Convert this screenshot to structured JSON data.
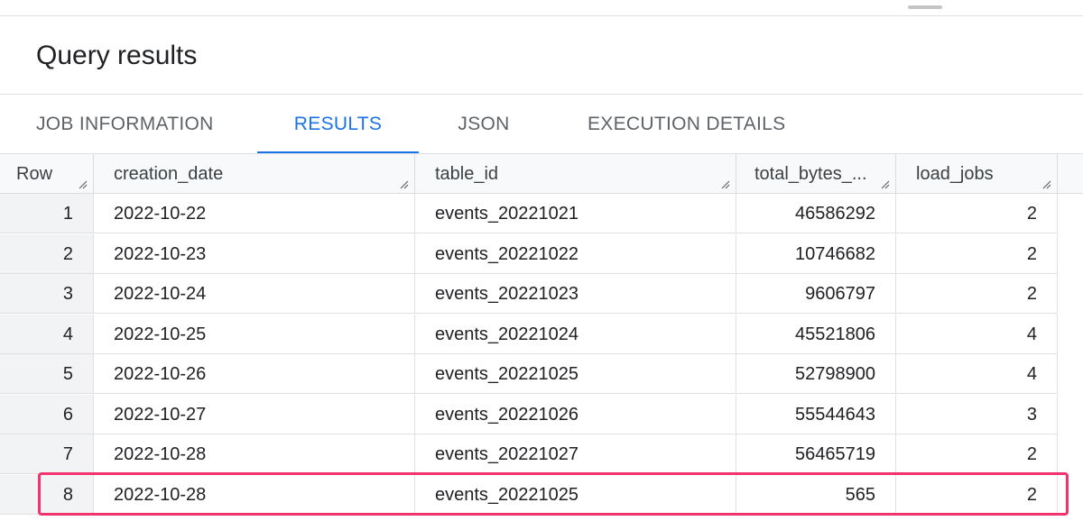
{
  "panel": {
    "title": "Query results"
  },
  "tabs": [
    {
      "label": "JOB INFORMATION",
      "active": false
    },
    {
      "label": "RESULTS",
      "active": true
    },
    {
      "label": "JSON",
      "active": false
    },
    {
      "label": "EXECUTION DETAILS",
      "active": false
    }
  ],
  "columns": [
    "Row",
    "creation_date",
    "table_id",
    "total_bytes_...",
    "load_jobs"
  ],
  "rows": [
    {
      "row": "1",
      "creation_date": "2022-10-22",
      "table_id": "events_20221021",
      "total_bytes": "46586292",
      "load_jobs": "2"
    },
    {
      "row": "2",
      "creation_date": "2022-10-23",
      "table_id": "events_20221022",
      "total_bytes": "10746682",
      "load_jobs": "2"
    },
    {
      "row": "3",
      "creation_date": "2022-10-24",
      "table_id": "events_20221023",
      "total_bytes": "9606797",
      "load_jobs": "2"
    },
    {
      "row": "4",
      "creation_date": "2022-10-25",
      "table_id": "events_20221024",
      "total_bytes": "45521806",
      "load_jobs": "4"
    },
    {
      "row": "5",
      "creation_date": "2022-10-26",
      "table_id": "events_20221025",
      "total_bytes": "52798900",
      "load_jobs": "4"
    },
    {
      "row": "6",
      "creation_date": "2022-10-27",
      "table_id": "events_20221026",
      "total_bytes": "55544643",
      "load_jobs": "3"
    },
    {
      "row": "7",
      "creation_date": "2022-10-28",
      "table_id": "events_20221027",
      "total_bytes": "56465719",
      "load_jobs": "2"
    },
    {
      "row": "8",
      "creation_date": "2022-10-28",
      "table_id": "events_20221025",
      "total_bytes": "565",
      "load_jobs": "2"
    }
  ],
  "highlighted_row": "8",
  "colors": {
    "accent": "#1a73e8",
    "highlight": "#f2336e",
    "header_bg": "#f8f9fa",
    "rownum_bg": "#f1f3f4"
  },
  "icons": {
    "column_resize": "resize-handle-icon",
    "panel_drag": "drag-handle-icon"
  }
}
